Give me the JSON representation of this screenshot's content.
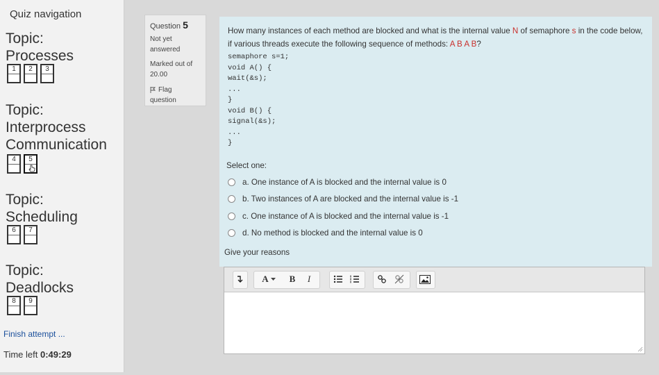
{
  "nav": {
    "title": "Quiz navigation",
    "topics": [
      {
        "label_line1": "Topic:",
        "label_line2": "Processes",
        "questions": [
          "1",
          "2",
          "3"
        ]
      },
      {
        "label_line1": "Topic:",
        "label_line2": "Interprocess",
        "label_line3": "Communication",
        "questions": [
          "4",
          "5"
        ]
      },
      {
        "label_line1": "Topic:",
        "label_line2": "Scheduling",
        "questions": [
          "6",
          "7"
        ]
      },
      {
        "label_line1": "Topic:",
        "label_line2": "Deadlocks",
        "questions": [
          "8",
          "9"
        ]
      }
    ],
    "finish": "Finish attempt ...",
    "time_left_label": "Time left",
    "time_left_value": "0:49:29"
  },
  "qinfo": {
    "question_label": "Question",
    "question_number": "5",
    "state_line1": "Not yet",
    "state_line2": "answered",
    "mark_line1": "Marked out of",
    "mark_line2": "20.00",
    "flag_line1": "Flag",
    "flag_line2": "question"
  },
  "question": {
    "prompt_part1": "How many instances of each method are blocked and what is the internal value",
    "hl_N": "N",
    "prompt_part2": "of semaphore",
    "hl_s": "s",
    "prompt_part3": "in the code below, if various threads execute the following sequence of methods:",
    "hl_seq": "A B A B",
    "prompt_part4": "?",
    "code": "semaphore s=1;\nvoid A() {\nwait(&s);\n...\n}\nvoid B() {\nsignal(&s);\n...\n}",
    "select_one": "Select one:",
    "options": [
      "a. One instance of A is blocked and the internal value is 0",
      "b. Two instances of A are blocked and the internal value is -1",
      "c. One instance of A is blocked and the internal value is -1",
      "d. No method is blocked and the internal value is 0"
    ],
    "reasons_label": "Give your reasons"
  },
  "editor": {
    "toolbar": {
      "font_size_label": "A",
      "bold_label": "B",
      "italic_label": "I"
    },
    "value": ""
  }
}
